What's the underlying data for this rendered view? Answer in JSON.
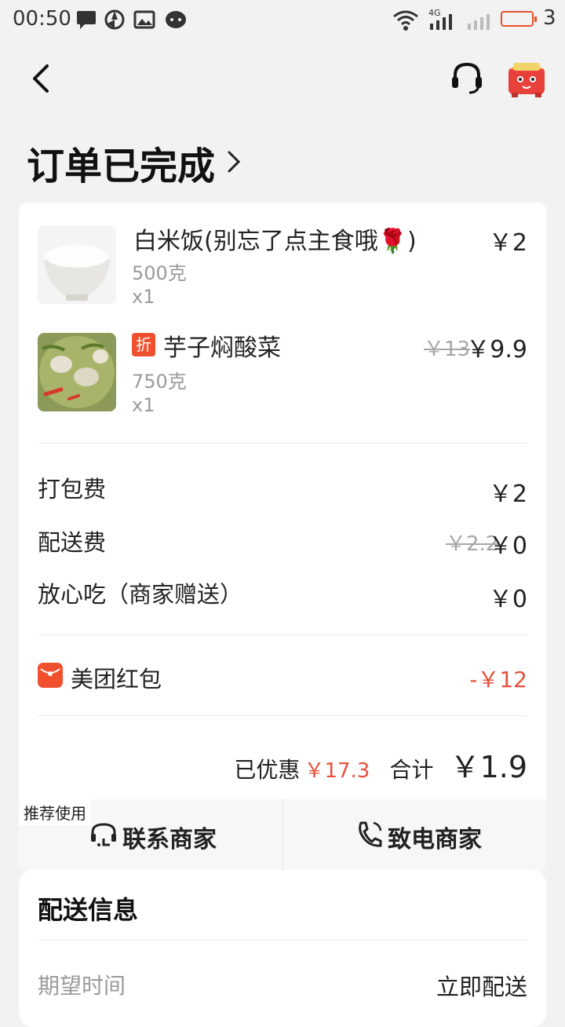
{
  "status_bar": {
    "time": "00:50",
    "network": "4G",
    "battery": "3"
  },
  "nav": {
    "back_icon": "chevron-left-icon",
    "service_icon": "headset-icon",
    "mascot_icon": "mascot-icon"
  },
  "order": {
    "status_title": "订单已完成"
  },
  "items": [
    {
      "name": "白米饭(别忘了点主食哦🌹)",
      "spec": "500克",
      "qty": "x1",
      "price": "￥2",
      "original_price": ""
    },
    {
      "badge": "折",
      "name": "芋子焖酸菜",
      "spec": "750克",
      "qty": "x1",
      "price": "￥9.9",
      "original_price": "￥13"
    }
  ],
  "fees": [
    {
      "label": "打包费",
      "value": "￥2",
      "original": ""
    },
    {
      "label": "配送费",
      "value": "￥0",
      "original": "￥2.2"
    },
    {
      "label": "放心吃（商家赠送）",
      "value": "￥0",
      "original": ""
    }
  ],
  "red_packet": {
    "label": "美团红包",
    "value": "-￥12"
  },
  "summary": {
    "discount_label": "已优惠",
    "discount_value": "￥17.3",
    "total_label": "合计",
    "total_value": "￥1.9"
  },
  "actions": {
    "tag": "推荐使用",
    "contact_label": "联系商家",
    "call_label": "致电商家"
  },
  "delivery": {
    "section_title": "配送信息",
    "expected_label": "期望时间",
    "expected_value": "立即配送"
  },
  "colors": {
    "accent": "#e8503a",
    "badge": "#f1502f",
    "background": "#f2f2f2"
  }
}
